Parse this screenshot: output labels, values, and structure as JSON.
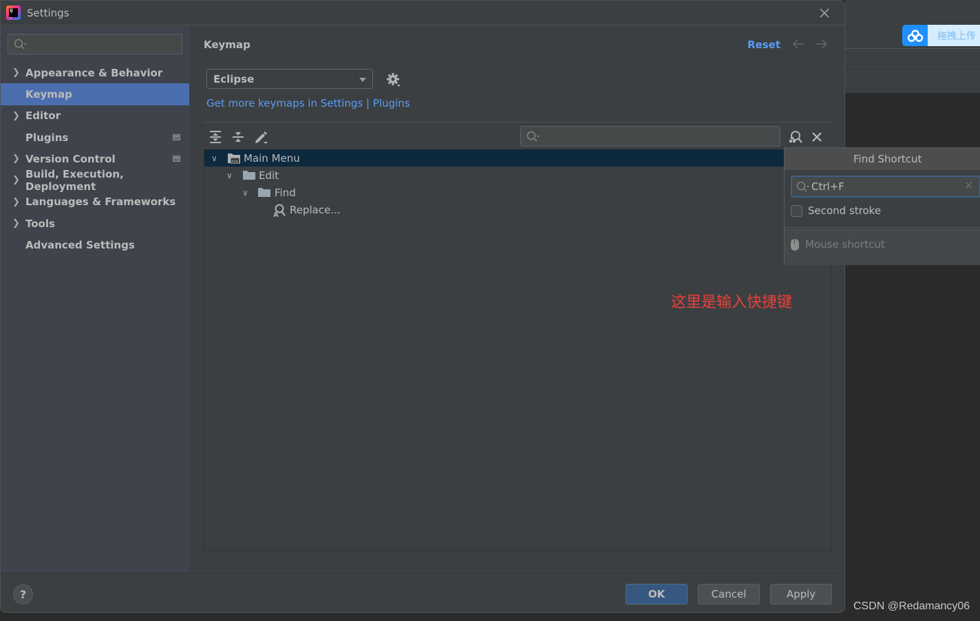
{
  "window": {
    "title": "Settings"
  },
  "sidebar": {
    "search_placeholder": "",
    "items": [
      {
        "label": "Appearance & Behavior",
        "expandable": true,
        "selected": false,
        "badge": false
      },
      {
        "label": "Keymap",
        "expandable": false,
        "selected": true,
        "badge": false
      },
      {
        "label": "Editor",
        "expandable": true,
        "selected": false,
        "badge": false
      },
      {
        "label": "Plugins",
        "expandable": false,
        "selected": false,
        "badge": true
      },
      {
        "label": "Version Control",
        "expandable": true,
        "selected": false,
        "badge": true
      },
      {
        "label": "Build, Execution, Deployment",
        "expandable": true,
        "selected": false,
        "badge": false
      },
      {
        "label": "Languages & Frameworks",
        "expandable": true,
        "selected": false,
        "badge": false
      },
      {
        "label": "Tools",
        "expandable": true,
        "selected": false,
        "badge": false
      },
      {
        "label": "Advanced Settings",
        "expandable": false,
        "selected": false,
        "badge": false
      }
    ]
  },
  "main": {
    "title": "Keymap",
    "reset_label": "Reset",
    "keymap_selected": "Eclipse",
    "plugins_link": "Get more keymaps in Settings | Plugins",
    "filter_value": "",
    "tree": [
      {
        "label": "Main Menu",
        "level": 0,
        "icon": "main-menu-icon",
        "expanded": true,
        "selected": true
      },
      {
        "label": "Edit",
        "level": 1,
        "icon": "folder-icon",
        "expanded": true,
        "selected": false
      },
      {
        "label": "Find",
        "level": 2,
        "icon": "folder-icon",
        "expanded": true,
        "selected": false
      },
      {
        "label": "Replace...",
        "level": 3,
        "icon": "replace-icon",
        "expanded": false,
        "selected": false
      }
    ],
    "annotation": "这里是输入快捷键"
  },
  "find_shortcut_popup": {
    "title": "Find Shortcut",
    "input_value": "Ctrl+F",
    "second_stroke_label": "Second stroke",
    "second_stroke_checked": false,
    "mouse_shortcut_label": "Mouse shortcut"
  },
  "footer": {
    "help": "?",
    "ok": "OK",
    "cancel": "Cancel",
    "apply": "Apply"
  },
  "overlay": {
    "upload_label": "拖拽上传",
    "watermark": "CSDN @Redamancy06"
  },
  "colors": {
    "accent": "#4b6eaf",
    "link": "#589df6",
    "tree_selection": "#0d293e",
    "annotation": "#e8403a",
    "ok_button": "#365880"
  }
}
